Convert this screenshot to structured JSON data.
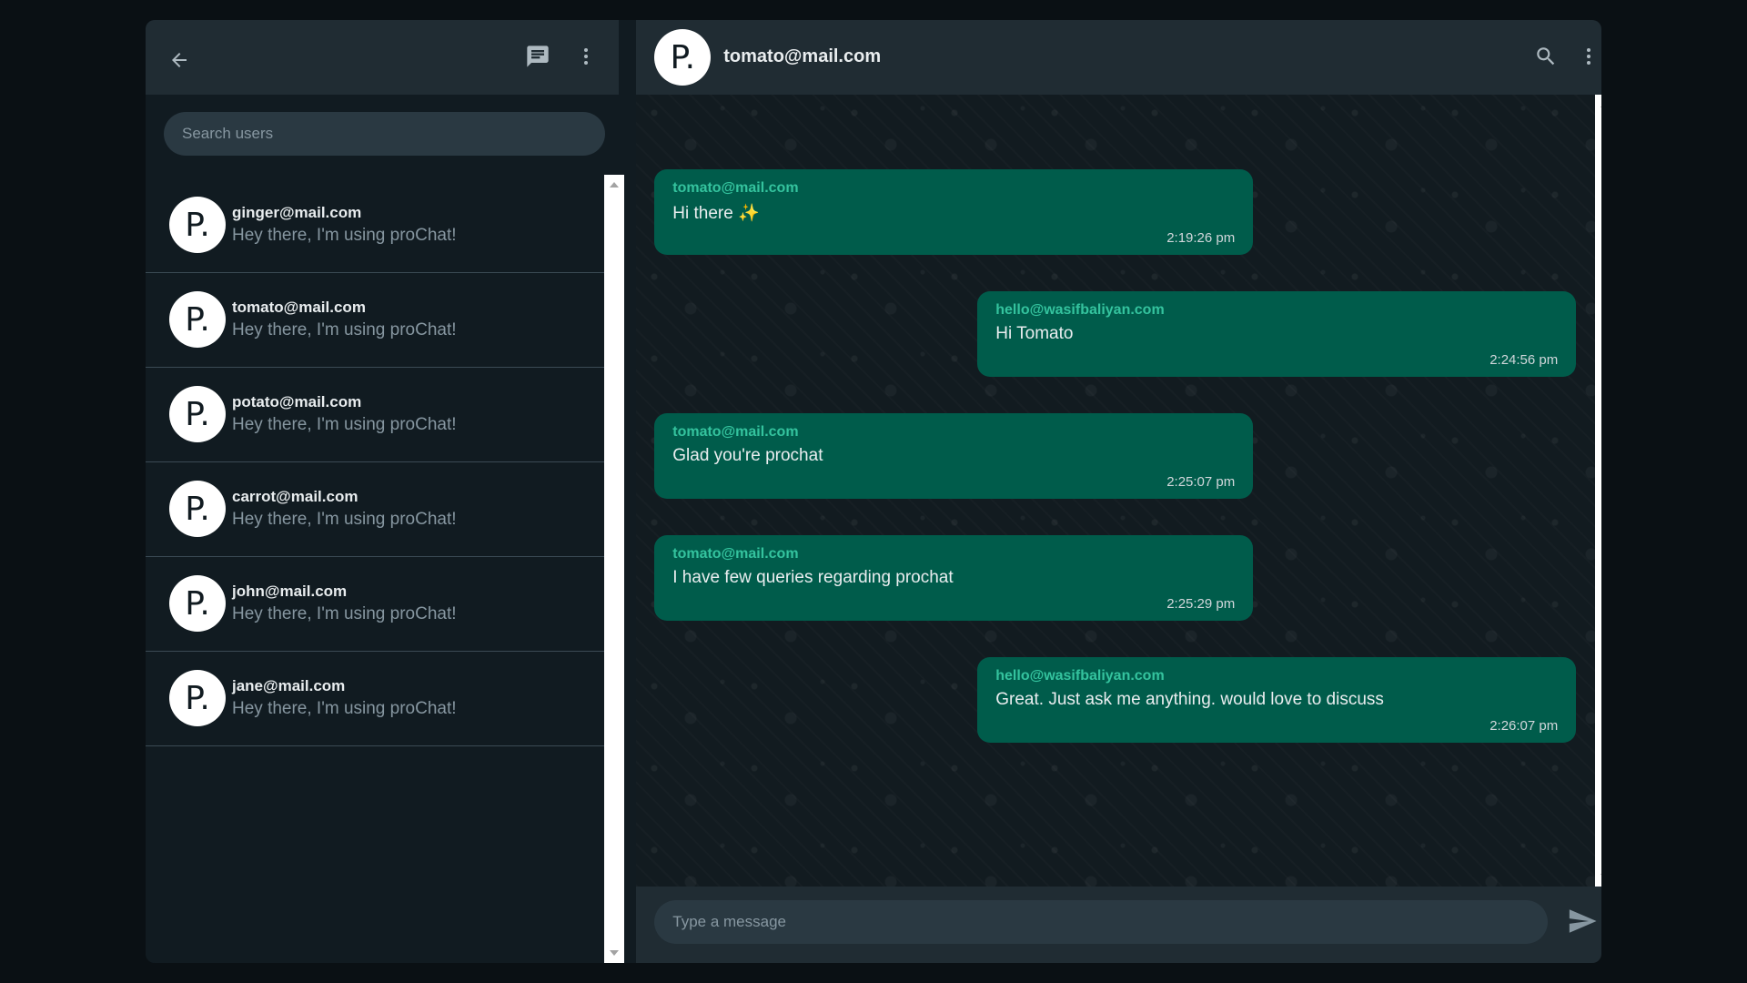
{
  "sidebar": {
    "search": {
      "placeholder": "Search users"
    },
    "users": [
      {
        "avatar": "P.",
        "email": "ginger@mail.com",
        "status": "Hey there, I'm using proChat!"
      },
      {
        "avatar": "P.",
        "email": "tomato@mail.com",
        "status": "Hey there, I'm using proChat!"
      },
      {
        "avatar": "P.",
        "email": "potato@mail.com",
        "status": "Hey there, I'm using proChat!"
      },
      {
        "avatar": "P.",
        "email": "carrot@mail.com",
        "status": "Hey there, I'm using proChat!"
      },
      {
        "avatar": "P.",
        "email": "john@mail.com",
        "status": "Hey there, I'm using proChat!"
      },
      {
        "avatar": "P.",
        "email": "jane@mail.com",
        "status": "Hey there, I'm using proChat!"
      }
    ],
    "icons": [
      "back-arrow-icon",
      "chat-icon",
      "more-vertical-icon"
    ]
  },
  "chat": {
    "header": {
      "avatar": "P.",
      "title": "tomato@mail.com"
    },
    "icons": [
      "search-icon",
      "more-vertical-icon",
      "send-icon"
    ],
    "messages": [
      {
        "sender": "tomato@mail.com",
        "text": "Hi there ✨",
        "time": "2:19:26 pm",
        "side": "left"
      },
      {
        "sender": "hello@wasifbaliyan.com",
        "text": "Hi Tomato",
        "time": "2:24:56 pm",
        "side": "right"
      },
      {
        "sender": "tomato@mail.com",
        "text": "Glad you're prochat",
        "time": "2:25:07 pm",
        "side": "left"
      },
      {
        "sender": "tomato@mail.com",
        "text": "I have few queries regarding prochat",
        "time": "2:25:29 pm",
        "side": "left"
      },
      {
        "sender": "hello@wasifbaliyan.com",
        "text": "Great. Just ask me anything. would love to discuss",
        "time": "2:26:07 pm",
        "side": "right"
      }
    ],
    "composer": {
      "placeholder": "Type a message"
    }
  },
  "colors": {
    "background": "#0a1014",
    "panel": "#111b21",
    "header": "#202c33",
    "bubble": "#005c4b",
    "sender_accent": "#34c39e",
    "input": "#2a3942"
  }
}
